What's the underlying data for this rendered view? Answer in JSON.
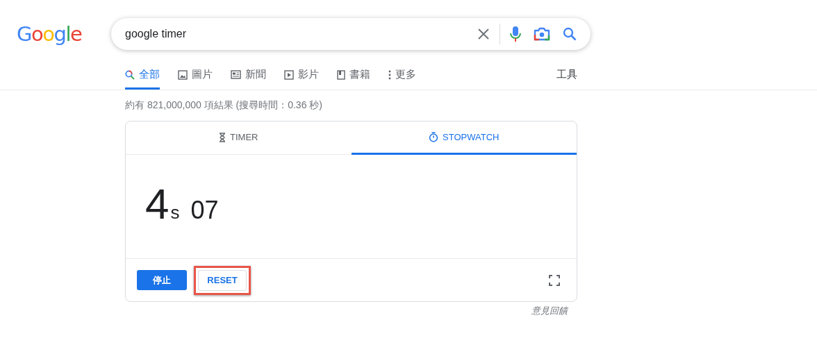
{
  "logo": {
    "text": "Google"
  },
  "search": {
    "value": "google timer"
  },
  "nav_tabs": [
    {
      "label": "全部",
      "kind": "search",
      "selected": true
    },
    {
      "label": "圖片",
      "kind": "image",
      "selected": false
    },
    {
      "label": "新聞",
      "kind": "news",
      "selected": false
    },
    {
      "label": "影片",
      "kind": "video",
      "selected": false
    },
    {
      "label": "書籍",
      "kind": "book",
      "selected": false
    },
    {
      "label": "更多",
      "kind": "more",
      "selected": false
    }
  ],
  "tools": "工具",
  "result_stats": "約有 821,000,000 項結果 (搜尋時間：0.36 秒)",
  "widget": {
    "tabs": [
      {
        "label": "TIMER",
        "kind": "timer",
        "selected": false
      },
      {
        "label": "STOPWATCH",
        "kind": "stopwatch",
        "selected": true
      }
    ],
    "seconds": "4",
    "seconds_unit": "s",
    "hundredths": "07",
    "stop_button": "停止",
    "reset_button": {
      "label": "RESET",
      "highlighted": true
    }
  },
  "feedback": "意見回饋"
}
